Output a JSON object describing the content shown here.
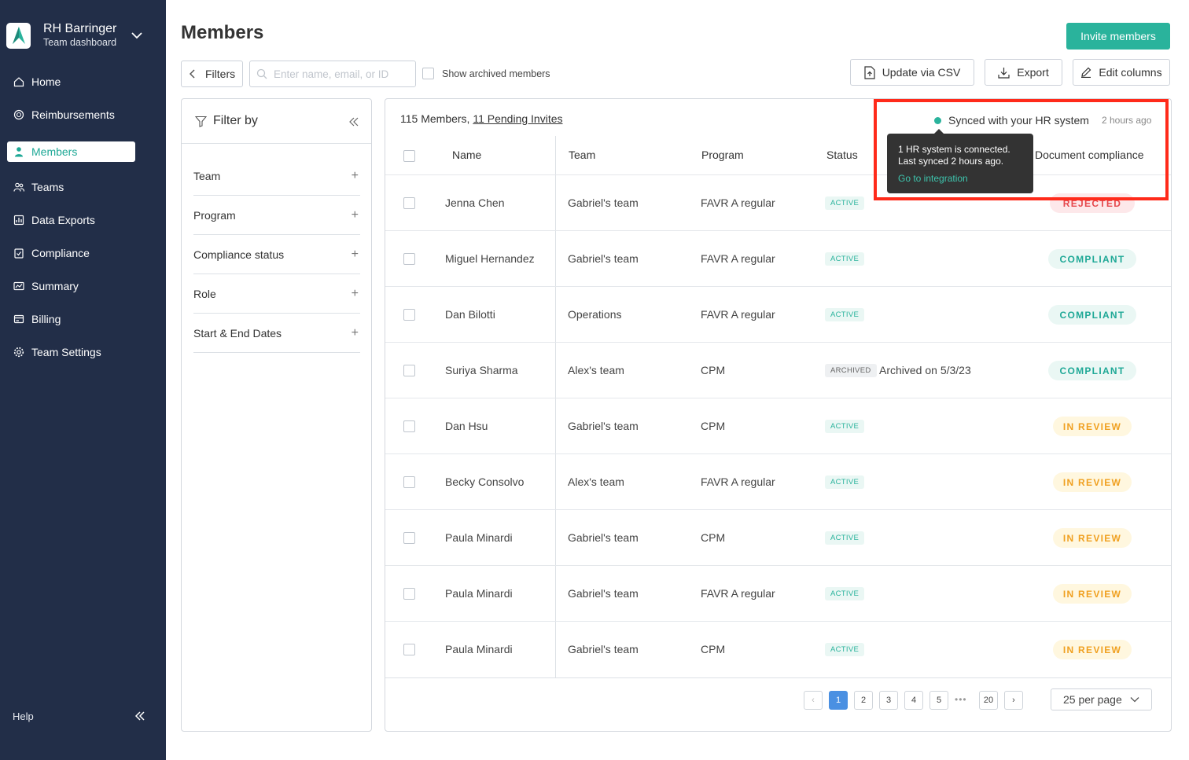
{
  "brand": {
    "name": "RH Barringer",
    "subtitle": "Team dashboard"
  },
  "nav": [
    {
      "label": "Home",
      "icon": "home-icon",
      "active": false
    },
    {
      "label": "Reimbursements",
      "icon": "reimbursements-icon",
      "active": false
    },
    {
      "label": "Members",
      "icon": "person-icon",
      "active": true
    },
    {
      "label": "Teams",
      "icon": "teams-icon",
      "active": false
    },
    {
      "label": "Data Exports",
      "icon": "data-exports-icon",
      "active": false
    },
    {
      "label": "Compliance",
      "icon": "compliance-icon",
      "active": false
    },
    {
      "label": "Summary",
      "icon": "summary-icon",
      "active": false
    },
    {
      "label": "Billing",
      "icon": "billing-icon",
      "active": false
    },
    {
      "label": "Team Settings",
      "icon": "gear-icon",
      "active": false
    }
  ],
  "sidebar_footer": {
    "help": "Help"
  },
  "header": {
    "title": "Members",
    "invite_label": "Invite members"
  },
  "toolbar": {
    "filters_label": "Filters",
    "search_placeholder": "Enter name, email, or ID",
    "show_archived_label": "Show archived members",
    "update_csv_label": "Update via CSV",
    "export_label": "Export",
    "edit_columns_label": "Edit columns"
  },
  "filter_panel": {
    "title": "Filter by",
    "sections": [
      "Team",
      "Program",
      "Compliance status",
      "Role",
      "Start & End Dates"
    ],
    "plus": "+"
  },
  "table": {
    "members_count": "115 Members,",
    "pending_invites": "11 Pending Invites",
    "columns": {
      "name": "Name",
      "team": "Team",
      "program": "Program",
      "status": "Status",
      "doc": "Document compliance"
    },
    "rows": [
      {
        "name": "Jenna Chen",
        "team": "Gabriel's team",
        "program": "FAVR A regular",
        "status": "ACTIVE",
        "note": "",
        "doc": "REJECTED",
        "doc_kind": "rejected"
      },
      {
        "name": "Miguel Hernandez",
        "team": "Gabriel's team",
        "program": "FAVR A regular",
        "status": "ACTIVE",
        "note": "",
        "doc": "COMPLIANT",
        "doc_kind": "compliant"
      },
      {
        "name": "Dan Bilotti",
        "team": "Operations",
        "program": "FAVR A regular",
        "status": "ACTIVE",
        "note": "",
        "doc": "COMPLIANT",
        "doc_kind": "compliant"
      },
      {
        "name": "Suriya Sharma",
        "team": "Alex's team",
        "program": "CPM",
        "status": "ARCHIVED",
        "note": "Archived on 5/3/23",
        "doc": "COMPLIANT",
        "doc_kind": "compliant"
      },
      {
        "name": "Dan Hsu",
        "team": "Gabriel's team",
        "program": "CPM",
        "status": "ACTIVE",
        "note": "",
        "doc": "IN REVIEW",
        "doc_kind": "review"
      },
      {
        "name": "Becky Consolvo",
        "team": "Alex's team",
        "program": "FAVR A regular",
        "status": "ACTIVE",
        "note": "",
        "doc": "IN REVIEW",
        "doc_kind": "review"
      },
      {
        "name": "Paula Minardi",
        "team": "Gabriel's team",
        "program": "CPM",
        "status": "ACTIVE",
        "note": "",
        "doc": "IN REVIEW",
        "doc_kind": "review"
      },
      {
        "name": "Paula Minardi",
        "team": "Gabriel's team",
        "program": "FAVR A regular",
        "status": "ACTIVE",
        "note": "",
        "doc": "IN REVIEW",
        "doc_kind": "review"
      },
      {
        "name": "Paula Minardi",
        "team": "Gabriel's team",
        "program": "CPM",
        "status": "ACTIVE",
        "note": "",
        "doc": "IN REVIEW",
        "doc_kind": "review"
      }
    ]
  },
  "pagination": {
    "prev": "‹",
    "next": "›",
    "pages": [
      "1",
      "2",
      "3",
      "4",
      "5"
    ],
    "ellipsis": "•••",
    "last": "20",
    "current": "1",
    "per_page": "25 per page"
  },
  "sync": {
    "label": "Synced with your HR system",
    "time": "2 hours ago",
    "tooltip_line1": "1 HR system is connected.",
    "tooltip_line2": "Last synced 2 hours ago.",
    "tooltip_link": "Go to integration"
  },
  "colors": {
    "sidebar": "#222e48",
    "accent": "#2ab39c",
    "highlight": "#ff2a1a",
    "page_current": "#4a90e2"
  }
}
